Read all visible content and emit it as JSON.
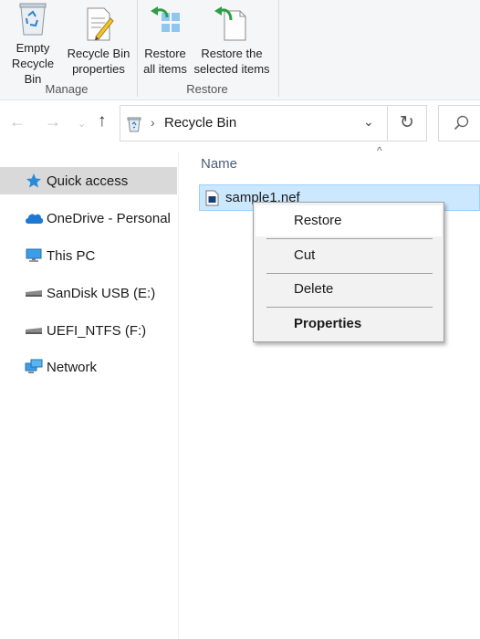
{
  "ribbon": {
    "buttons": [
      {
        "label_line1": "Empty",
        "label_line2": "Recycle Bin",
        "icon": "empty-recycle-bin-icon"
      },
      {
        "label_line1": "Recycle Bin",
        "label_line2": "properties",
        "icon": "properties-icon"
      },
      {
        "label_line1": "Restore",
        "label_line2": "all items",
        "icon": "restore-all-icon"
      },
      {
        "label_line1": "Restore the",
        "label_line2": "selected items",
        "icon": "restore-selected-icon"
      }
    ],
    "groups": [
      "Manage",
      "Restore"
    ]
  },
  "address": {
    "location": "Recycle Bin",
    "back_icon": "back-arrow-icon",
    "forward_icon": "forward-arrow-icon",
    "recent_icon": "chevron-down-icon",
    "up_icon": "up-arrow-icon",
    "refresh_icon": "refresh-icon",
    "search_icon": "search-icon"
  },
  "sidebar": {
    "items": [
      {
        "label": "Quick access",
        "icon": "star-icon",
        "selected": true
      },
      {
        "label": "OneDrive - Personal",
        "icon": "cloud-icon",
        "selected": false
      },
      {
        "label": "This PC",
        "icon": "computer-icon",
        "selected": false
      },
      {
        "label": "SanDisk USB (E:)",
        "icon": "drive-icon",
        "selected": false
      },
      {
        "label": "UEFI_NTFS (F:)",
        "icon": "drive-icon",
        "selected": false
      },
      {
        "label": "Network",
        "icon": "network-icon",
        "selected": false
      }
    ]
  },
  "content": {
    "column_header": "Name",
    "files": [
      {
        "name": "sample1.nef",
        "selected": true
      }
    ]
  },
  "context_menu": {
    "items": [
      "Restore",
      "Cut",
      "Delete",
      "Properties"
    ],
    "hovered": "Restore",
    "bold": "Properties"
  },
  "colors": {
    "selection": "#cce8ff",
    "accent": "#0078d7",
    "restore_arrow": "#2e9e45"
  }
}
